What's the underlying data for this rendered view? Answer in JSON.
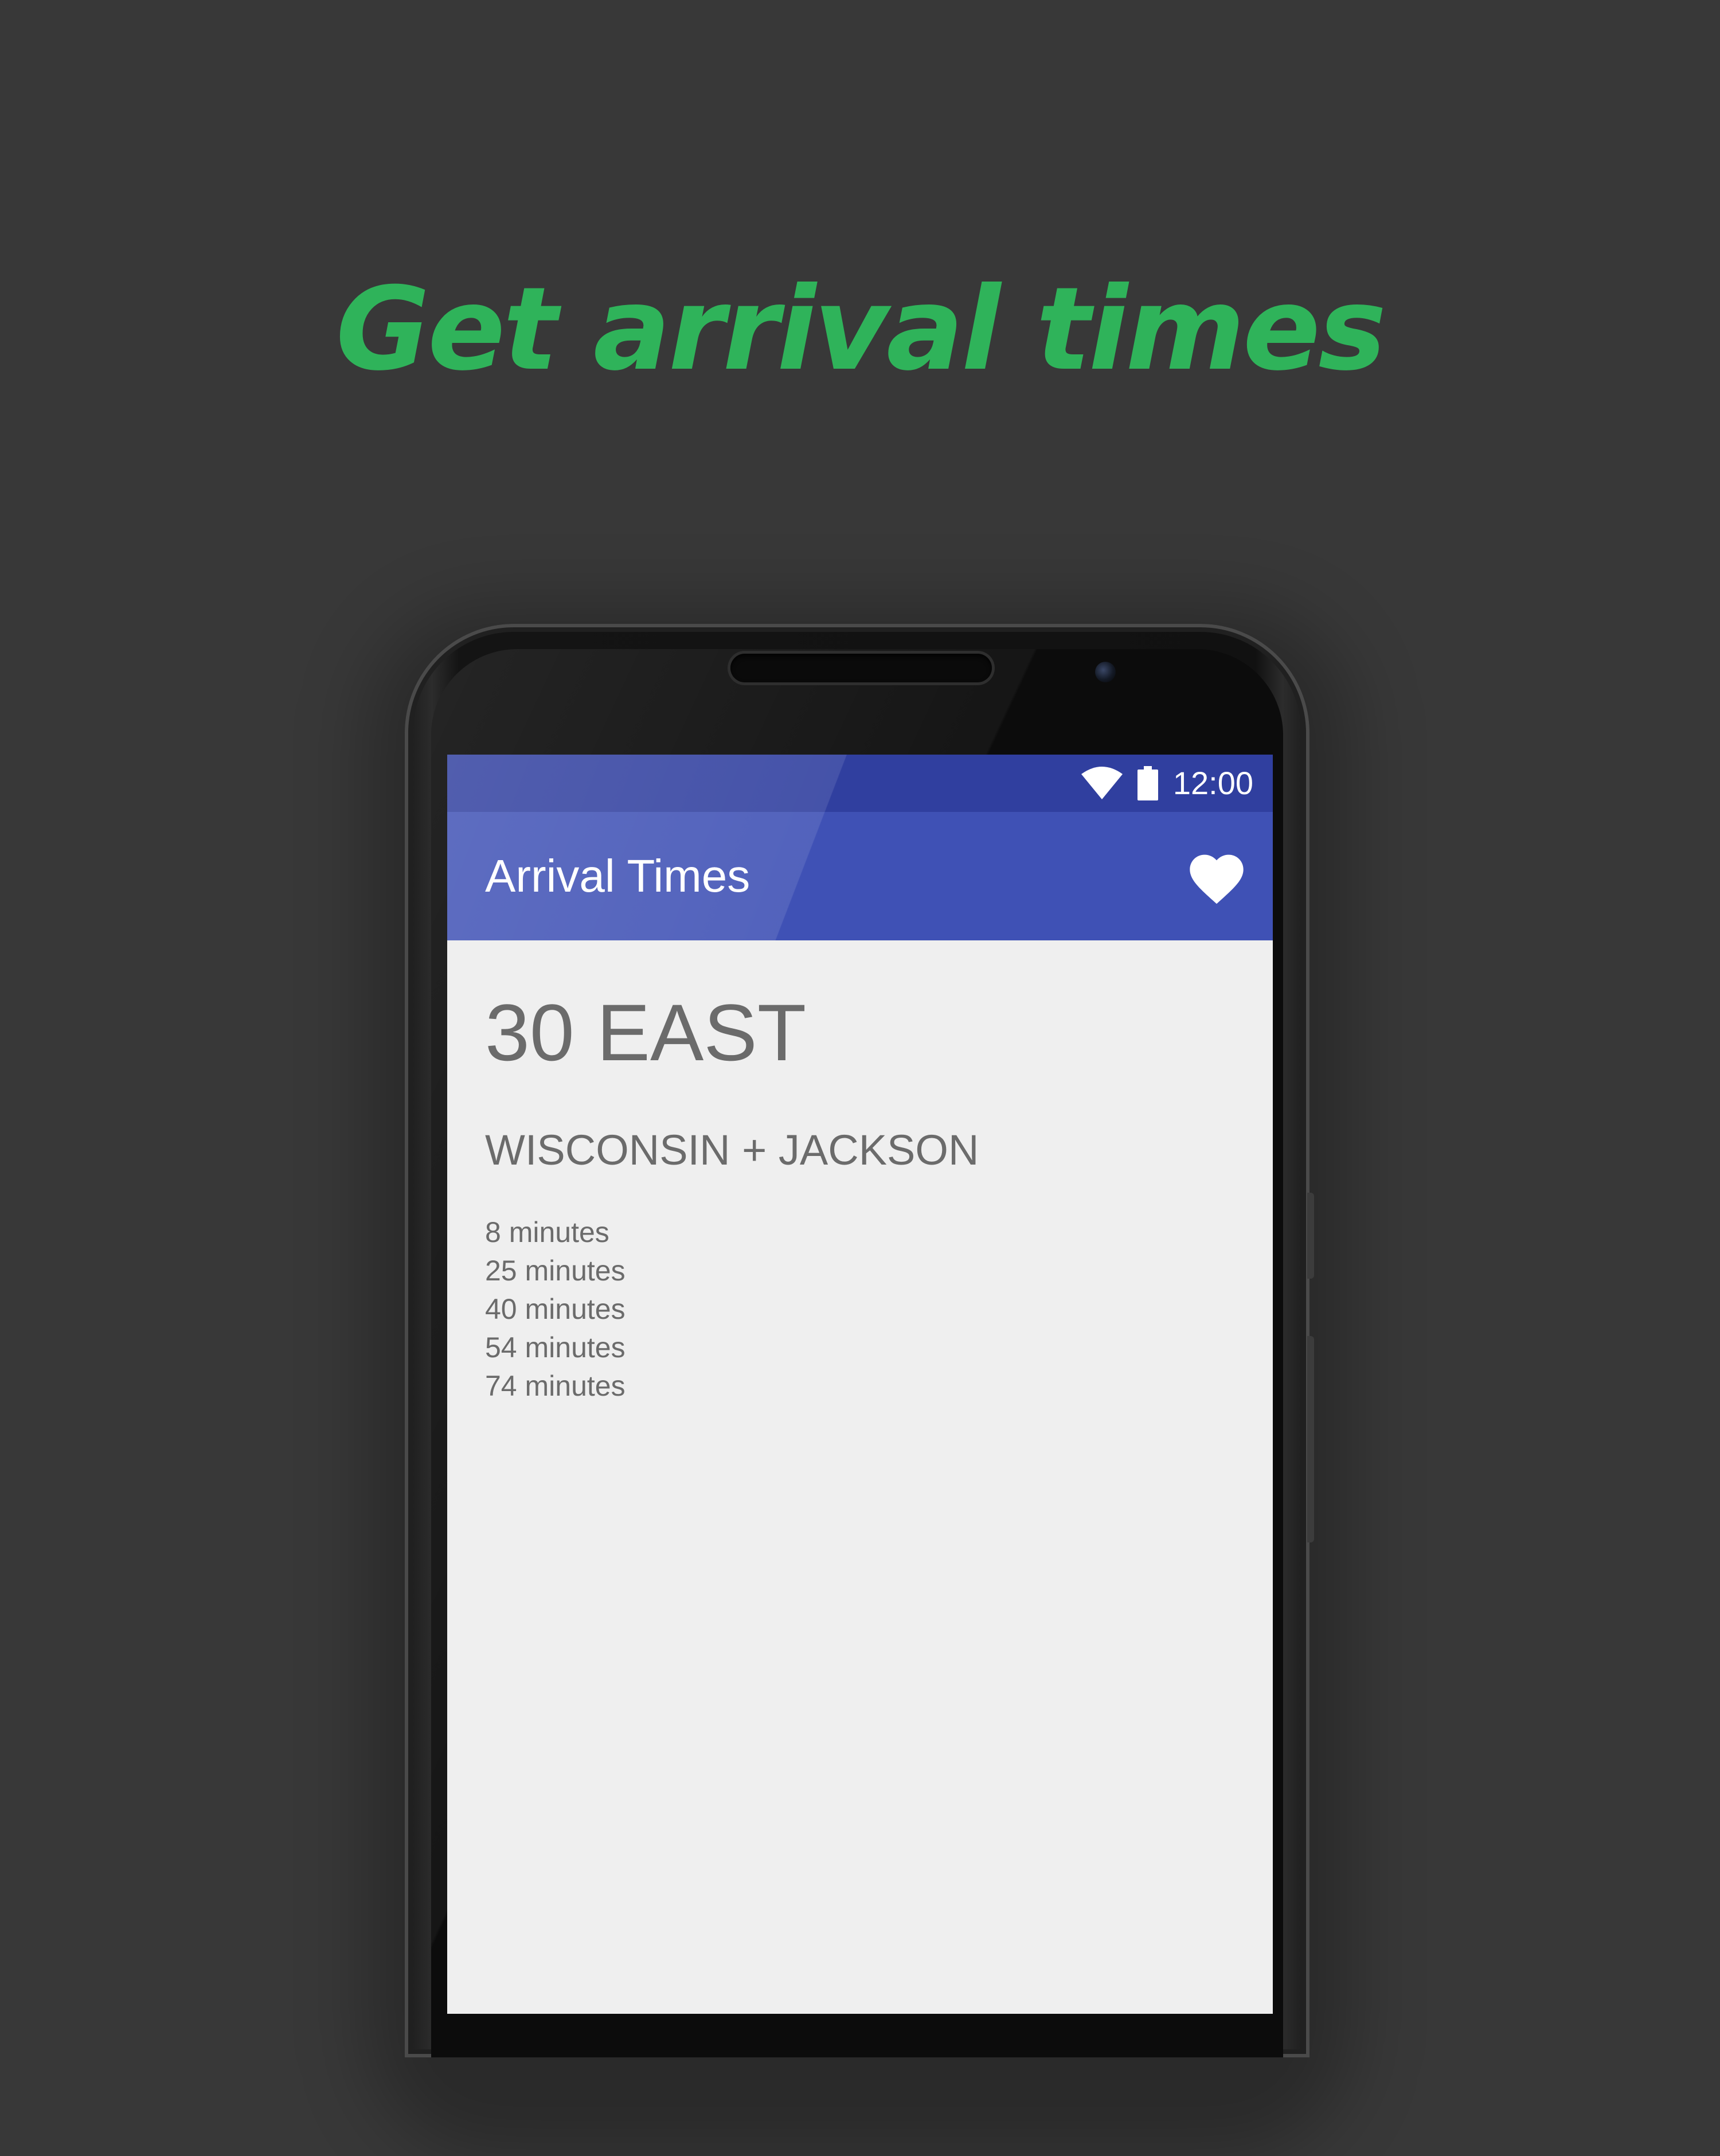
{
  "headline": "Get arrival times",
  "status_bar": {
    "time": "12:00",
    "icons": [
      "wifi-icon",
      "battery-icon"
    ]
  },
  "app_bar": {
    "title": "Arrival Times",
    "action_icon": "heart-icon"
  },
  "content": {
    "route": "30 EAST",
    "stop": "WISCONSIN + JACKSON",
    "arrival_times": [
      "8 minutes",
      "25 minutes",
      "40 minutes",
      "54 minutes",
      "74 minutes"
    ]
  },
  "colors": {
    "background": "#383838",
    "headline": "#2fb35a",
    "status_bar": "#303f9f",
    "app_bar": "#3f51b5",
    "screen": "#efefef",
    "text": "#6b6b6b"
  }
}
